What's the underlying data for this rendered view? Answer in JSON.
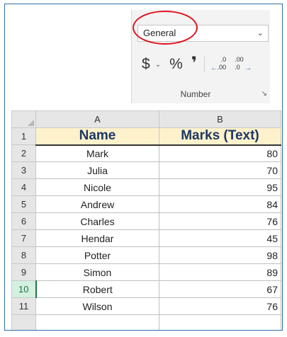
{
  "ribbon": {
    "number_format_value": "General",
    "currency_symbol": "$",
    "percent_symbol": "%",
    "comma_symbol": "❜",
    "increase_decimal": {
      "top": ".0",
      "bottom": ".00"
    },
    "decrease_decimal": {
      "top": ".00",
      "bottom": ".0"
    },
    "group_label": "Number"
  },
  "sheet": {
    "columns": [
      "A",
      "B"
    ],
    "headers": {
      "name": "Name",
      "marks": "Marks (Text)"
    },
    "rows": [
      {
        "num": "1"
      },
      {
        "num": "2",
        "name": "Mark",
        "marks": "80"
      },
      {
        "num": "3",
        "name": "Julia",
        "marks": "70"
      },
      {
        "num": "4",
        "name": "Nicole",
        "marks": "95"
      },
      {
        "num": "5",
        "name": "Andrew",
        "marks": "84"
      },
      {
        "num": "6",
        "name": "Charles",
        "marks": "76"
      },
      {
        "num": "7",
        "name": "Hendar",
        "marks": "45"
      },
      {
        "num": "8",
        "name": "Potter",
        "marks": "98"
      },
      {
        "num": "9",
        "name": "Simon",
        "marks": "89"
      },
      {
        "num": "10",
        "name": "Robert",
        "marks": "67"
      },
      {
        "num": "11",
        "name": "Wilson",
        "marks": "76"
      }
    ]
  },
  "colors": {
    "highlight": "#e0141e",
    "header_fill": "#fdf2cc",
    "header_text": "#1f3864",
    "selected_row": "#217346"
  }
}
